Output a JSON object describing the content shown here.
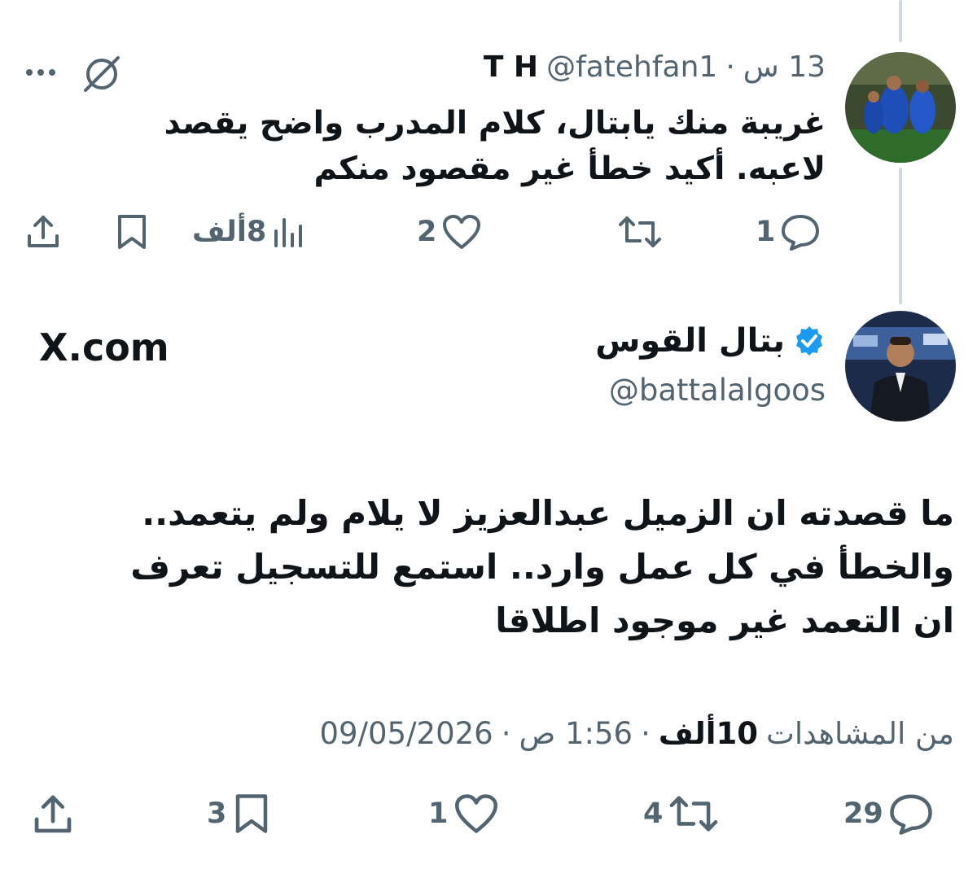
{
  "reply": {
    "display_name": "T H",
    "handle": "@fatehfan1",
    "sep": "·",
    "time": "13 س",
    "text_line1": "غريبة منك يابتال، كلام المدرب واضح يقصد",
    "text_line2": "لاعبه. أكيد خطأ غير مقصود منكم",
    "reply_count": "1",
    "retweet_count": "",
    "like_count": "2",
    "views_count": "8ألف"
  },
  "main": {
    "display_name": "بتال القوس",
    "handle": "@battalalgoos",
    "source_label": "X.com",
    "text_line1": "ما قصدته ان الزميل عبدالعزيز لا يلام ولم يتعمد..",
    "text_line2": "والخطأ في كل عمل وارد.. استمع للتسجيل تعرف",
    "text_line3": "ان التعمد غير موجود اطلاقا",
    "date": "09/05/2026",
    "time": "1:56 ص",
    "sep": "·",
    "views_num": "10ألف",
    "views_label": "من المشاهدات",
    "reply_count": "29",
    "retweet_count": "4",
    "like_count": "1",
    "bookmark_count": "3"
  },
  "colors": {
    "verified": "#1d9bf0",
    "muted": "#536471",
    "text": "#0f1419",
    "thread": "#cfd9de"
  }
}
